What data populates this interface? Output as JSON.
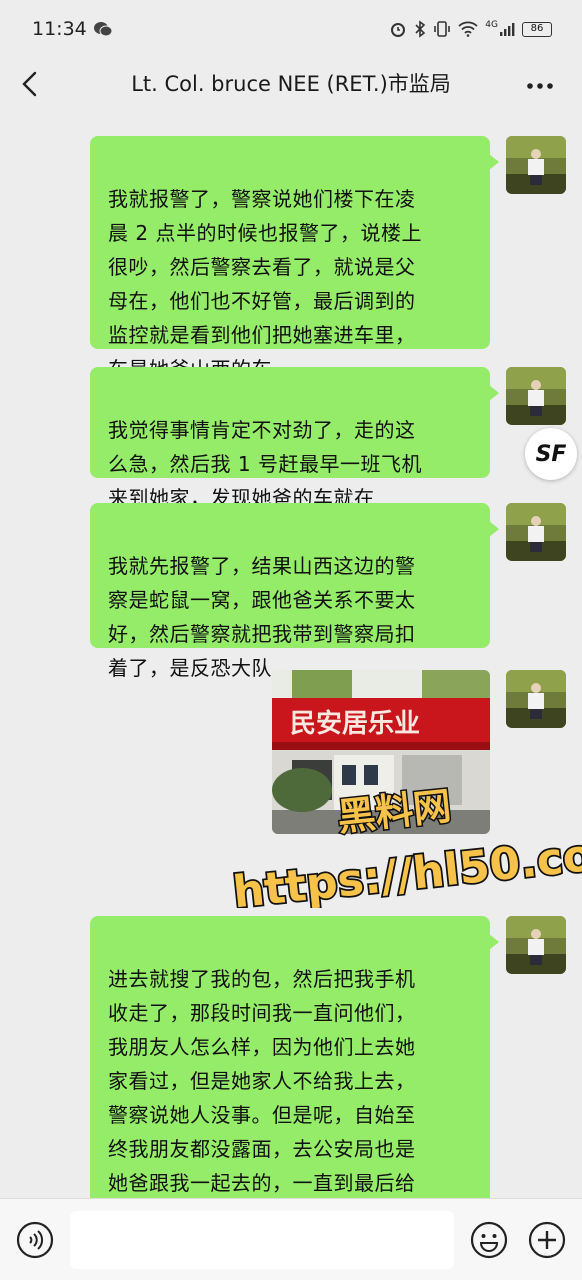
{
  "status": {
    "time": "11:34",
    "network_badge": "4G",
    "battery": "86"
  },
  "nav": {
    "title": "Lt. Col. bruce NEE (RET.)市监局"
  },
  "messages": [
    {
      "type": "text",
      "text": "我就报警了，警察说她们楼下在凌\n晨 2 点半的时候也报警了，说楼上\n很吵，然后警察去看了，就说是父\n母在，他们也不好管，最后调到的\n监控就是看到他们把她塞进车里，\n车是她爸山西的车"
    },
    {
      "type": "text",
      "text": "我觉得事情肯定不对劲了，走的这\n么急，然后我 1 号赶最早一班飞机\n来到她家，发现她爸的车就在"
    },
    {
      "type": "text",
      "text": "我就先报警了，结果山西这边的警\n察是蛇鼠一窝，跟他爸关系不要太\n好，然后警察就把我带到警察局扣\n着了，是反恐大队"
    },
    {
      "type": "image",
      "sign_text": "民安居乐业"
    },
    {
      "type": "text",
      "text": "进去就搜了我的包，然后把我手机\n收走了，那段时间我一直问他们，\n我朋友人怎么样，因为他们上去她\n家看过，但是她家人不给我上去，\n警察说她人没事。但是呢，自始至\n终我朋友都没露面，去公安局也是\n她爸跟我一起去的，一直到最后给\n我做笔录的警察，才给我说我朋友\n现在情况不太好，但是具体的就不"
    }
  ],
  "floating": {
    "sf_label": "SF"
  },
  "watermark": {
    "line1": "黑料网",
    "line2": "https://hl50.co"
  },
  "input": {
    "placeholder": ""
  }
}
